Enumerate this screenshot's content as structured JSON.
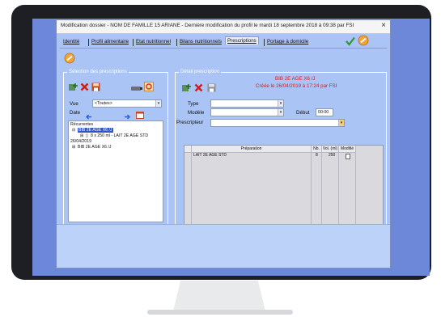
{
  "window": {
    "title": "Modification dossier - NOM DE FAMILLE 15 ARIANE - Dernière modification du profil le mardi 18 septembre 2018 à 09:38 par FSI",
    "close_glyph": "×"
  },
  "tabs": [
    {
      "label": "Identité"
    },
    {
      "label": "Profil alimentaire"
    },
    {
      "label": "Etat nutritionnel"
    },
    {
      "label": "Bilans nutritionnels"
    },
    {
      "label": "Prescriptions"
    },
    {
      "label": "Portage à domicile"
    }
  ],
  "active_tab": "Prescriptions",
  "left_panel": {
    "title": "Sélection des prescriptions",
    "vue_label": "Vue",
    "vue_value": "<Toutes>",
    "date_label": "Date",
    "tree": [
      {
        "text": "Récurrentes"
      },
      {
        "text": "BIB 2E AGE X6 /J"
      },
      {
        "text": "8 x 250 ml - LAIT 2E AGE STD"
      },
      {
        "text": "26/04/2019"
      },
      {
        "text": "BIB 2E AGE X6 /J"
      }
    ]
  },
  "right_panel": {
    "title": "Détail prescription",
    "heading": "BIB 2E AGE X6 /J",
    "created": "Créée le 26/04/2019 à 17:24 par FSI",
    "type_label": "Type",
    "modele_label": "Modèle",
    "debut_label": "Début",
    "debut_value": "00:00",
    "prescripteur_label": "Prescripteur",
    "columns": [
      "Préparation",
      "Nb.",
      "Vol. (ml)",
      "Modifié"
    ],
    "rows": [
      {
        "preparation": "LAIT 2E AGE STD",
        "nb": "8",
        "vol": "250"
      }
    ]
  },
  "icons": {
    "check": "check-icon",
    "close": "close-x-icon"
  },
  "colors": {
    "window_bg": "#a9c4f5",
    "screen_bg": "#6d87d9",
    "accent_red": "#d01f1f"
  }
}
